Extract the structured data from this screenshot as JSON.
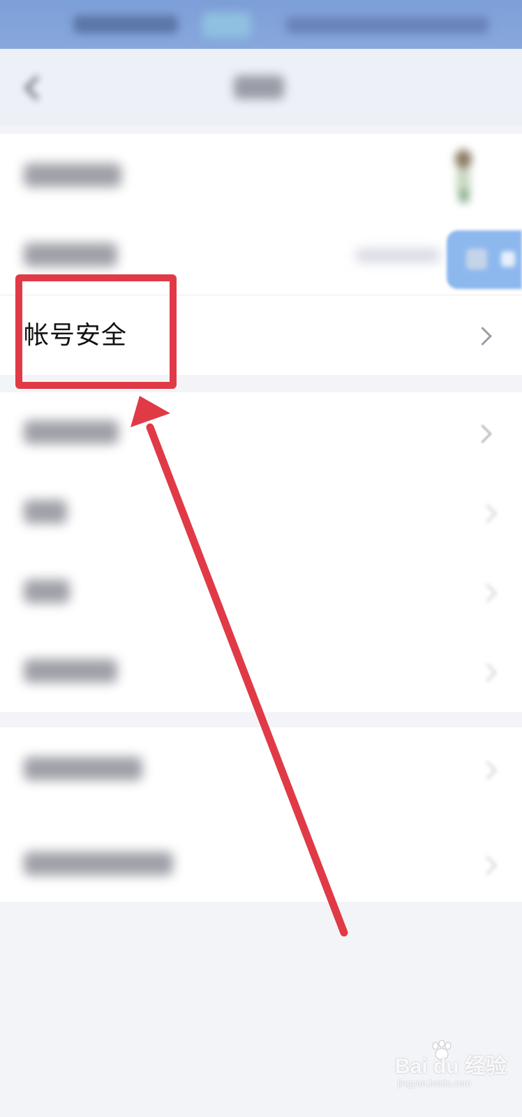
{
  "rows": {
    "account_security": {
      "label": "帐号安全"
    }
  },
  "watermark": {
    "main": "Bai du 经验",
    "sub": "jingyan.baidu.com"
  },
  "colors": {
    "statusbar": "#7d9fd8",
    "annotation_red": "#e03a47",
    "page_bg": "#f3f4f8",
    "card_bg": "#ffffff"
  },
  "icons": [
    "back-icon",
    "chevron-right-icon",
    "avatar",
    "baidu-paw-icon"
  ]
}
